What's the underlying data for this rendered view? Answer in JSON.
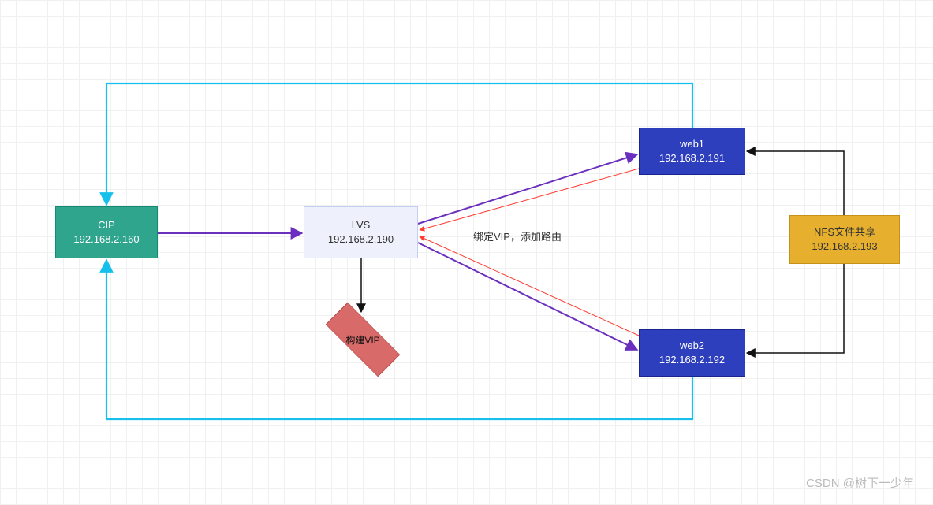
{
  "nodes": {
    "cip": {
      "title": "CIP",
      "ip": "192.168.2.160"
    },
    "lvs": {
      "title": "LVS",
      "ip": "192.168.2.190"
    },
    "web1": {
      "title": "web1",
      "ip": "192.168.2.191"
    },
    "web2": {
      "title": "web2",
      "ip": "192.168.2.192"
    },
    "nfs": {
      "title": "NFS文件共享",
      "ip": "192.168.2.193"
    },
    "vip": {
      "label": "构建VIP"
    }
  },
  "labels": {
    "bind_vip": "绑定VIP，添加路由"
  },
  "watermark": "CSDN @树下一少年",
  "colors": {
    "cyan": "#17c0eb",
    "purple": "#6b2fbf",
    "red": "#ff3b30",
    "black": "#111"
  }
}
